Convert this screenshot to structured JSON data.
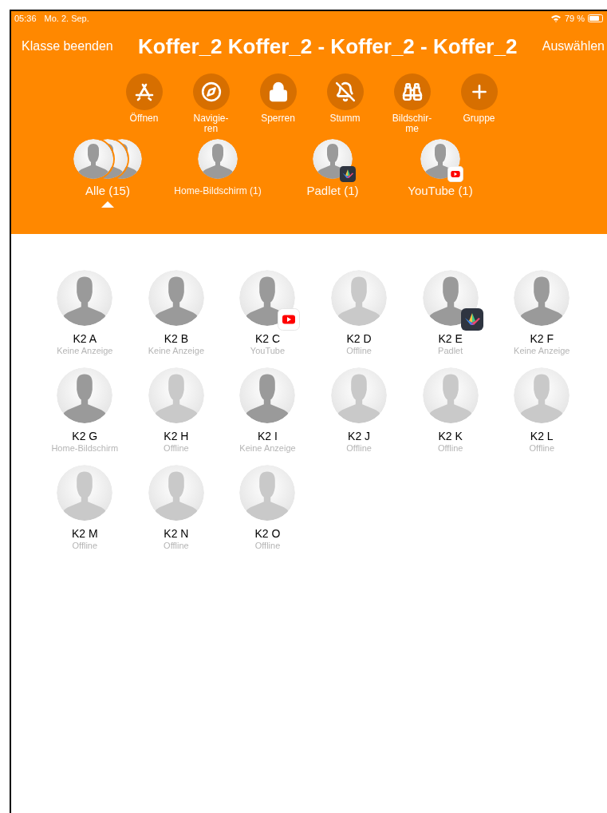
{
  "status_bar": {
    "time": "05:36",
    "date": "Mo. 2. Sep.",
    "battery": "79 %"
  },
  "nav": {
    "left": "Klasse beenden",
    "title": "Koffer_2 Koffer_2 - Koffer_2 - Koffer_2",
    "right": "Auswählen"
  },
  "actions": [
    {
      "kind": "appstore",
      "label": "Öffnen"
    },
    {
      "kind": "compass",
      "label": "Navigie-\nren"
    },
    {
      "kind": "lock",
      "label": "Sperren"
    },
    {
      "kind": "mute",
      "label": "Stumm"
    },
    {
      "kind": "binoculars",
      "label": "Bildschir-\nme"
    },
    {
      "kind": "plus",
      "label": "Gruppe"
    }
  ],
  "groups": [
    {
      "label": "Alle (15)",
      "kind": "stack",
      "selected": true
    },
    {
      "label": "Home-Bildschirm (1)",
      "kind": "home",
      "selected": false
    },
    {
      "label": "Padlet (1)",
      "kind": "padlet",
      "selected": false
    },
    {
      "label": "YouTube (1)",
      "kind": "youtube",
      "selected": false
    }
  ],
  "students": [
    {
      "name": "K2 A",
      "status": "Keine Anzeige",
      "offline": false,
      "kind": "plain"
    },
    {
      "name": "K2 B",
      "status": "Keine Anzeige",
      "offline": false,
      "kind": "plain"
    },
    {
      "name": "K2 C",
      "status": "YouTube",
      "offline": false,
      "kind": "youtube"
    },
    {
      "name": "K2 D",
      "status": "Offline",
      "offline": true,
      "kind": "plain"
    },
    {
      "name": "K2 E",
      "status": "Padlet",
      "offline": false,
      "kind": "padlet"
    },
    {
      "name": "K2 F",
      "status": "Keine Anzeige",
      "offline": false,
      "kind": "plain"
    },
    {
      "name": "K2 G",
      "status": "Home-Bildschirm",
      "offline": false,
      "kind": "plain"
    },
    {
      "name": "K2 H",
      "status": "Offline",
      "offline": true,
      "kind": "plain"
    },
    {
      "name": "K2 I",
      "status": "Keine Anzeige",
      "offline": false,
      "kind": "plain"
    },
    {
      "name": "K2 J",
      "status": "Offline",
      "offline": true,
      "kind": "plain"
    },
    {
      "name": "K2 K",
      "status": "Offline",
      "offline": true,
      "kind": "plain"
    },
    {
      "name": "K2 L",
      "status": "Offline",
      "offline": true,
      "kind": "plain"
    },
    {
      "name": "K2 M",
      "status": "Offline",
      "offline": true,
      "kind": "plain"
    },
    {
      "name": "K2 N",
      "status": "Offline",
      "offline": true,
      "kind": "plain"
    },
    {
      "name": "K2 O",
      "status": "Offline",
      "offline": true,
      "kind": "plain"
    }
  ]
}
